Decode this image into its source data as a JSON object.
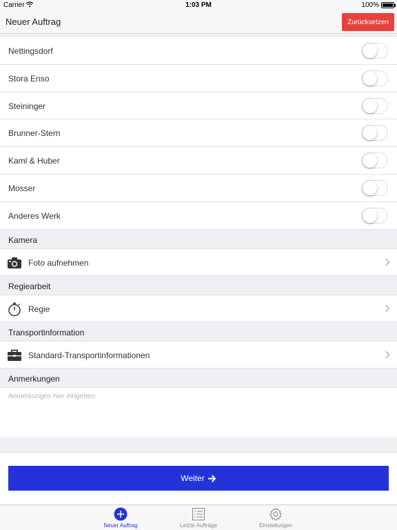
{
  "status_bar": {
    "carrier": "Carrier",
    "time": "1:03 PM",
    "battery": "100%"
  },
  "nav": {
    "title": "Neuer Auftrag",
    "reset_label": "Zurücksetzen"
  },
  "plants": [
    {
      "label": "Nettingsdorf",
      "on": false
    },
    {
      "label": "Stora Enso",
      "on": false
    },
    {
      "label": "Steininger",
      "on": false
    },
    {
      "label": "Brunner-Stern",
      "on": false
    },
    {
      "label": "Kaml & Huber",
      "on": false
    },
    {
      "label": "Mosser",
      "on": false
    },
    {
      "label": "Anderes Werk",
      "on": false
    }
  ],
  "sections": {
    "camera": {
      "header": "Kamera",
      "row": "Foto aufnehmen",
      "icon": "camera-icon"
    },
    "regie": {
      "header": "Regiearbeit",
      "row": "Regie",
      "icon": "stopwatch-icon"
    },
    "transport": {
      "header": "Transportinformation",
      "row": "Standard-Transportinformationen",
      "icon": "briefcase-icon"
    },
    "notes": {
      "header": "Anmerkungen",
      "placeholder": "Anmerkungen hier eingeben"
    }
  },
  "next_button": {
    "label": "Weiter"
  },
  "tabs": [
    {
      "label": "Neuer Auftrag",
      "icon": "plus-circle-icon",
      "active": true
    },
    {
      "label": "Letzte Aufträge",
      "icon": "list-icon",
      "active": false
    },
    {
      "label": "Einstellungen",
      "icon": "gear-icon",
      "active": false
    }
  ],
  "colors": {
    "accent": "#2333d9",
    "reset": "#e8403c"
  }
}
